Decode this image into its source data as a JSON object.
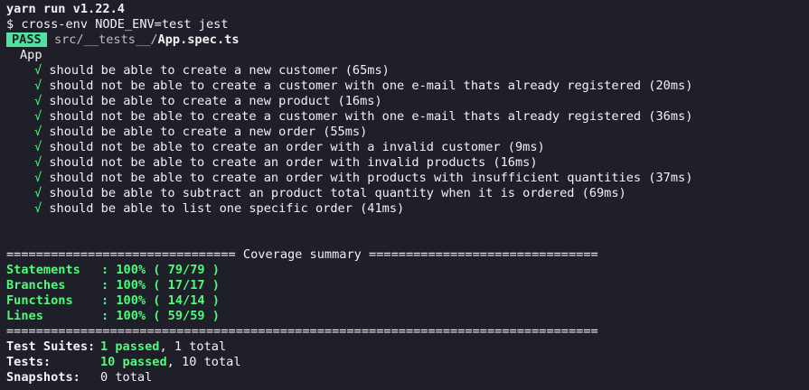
{
  "header": {
    "yarn_version": "yarn run v1.22.4",
    "command": "$ cross-env NODE_ENV=test jest"
  },
  "result": {
    "badge": "PASS",
    "path_dir": "src/__tests__/",
    "path_file": "App.spec.ts"
  },
  "suite": {
    "name": "App",
    "check_glyph": "√",
    "tests": [
      "should be able to create a new customer (65ms)",
      "should not be able to create a customer with one e-mail thats already registered (20ms)",
      "should be able to create a new product (16ms)",
      "should not be able to create a customer with one e-mail thats already registered (36ms)",
      "should be able to create a new order (55ms)",
      "should not be able to create an order with a invalid customer (9ms)",
      "should not be able to create an order with invalid products (16ms)",
      "should not be able to create an order with products with insufficient quantities (37ms)",
      "should be able to subtract an product total quantity when it is ordered (69ms)",
      "should be able to list one specific order (41ms)"
    ]
  },
  "coverage": {
    "header": "=============================== Coverage summary ===============================",
    "rows": [
      {
        "label": "Statements",
        "value": ": 100% ( 79/79 )"
      },
      {
        "label": "Branches",
        "value": ": 100% ( 17/17 )"
      },
      {
        "label": "Functions",
        "value": ": 100% ( 14/14 )"
      },
      {
        "label": "Lines",
        "value": ": 100% ( 59/59 )"
      }
    ],
    "footer": "================================================================================"
  },
  "summary": {
    "suites_label": "Test Suites:",
    "suites_passed": "1 passed",
    "suites_total": ", 1 total",
    "tests_label": "Tests:",
    "tests_passed": "10 passed",
    "tests_total": ", 10 total",
    "snapshots_label": "Snapshots:",
    "snapshots_value": "0 total"
  },
  "colors": {
    "background": "#1e1f29",
    "pass_badge": "#50e3a0",
    "success_green": "#50fa7b",
    "text": "#f2f2f2"
  }
}
